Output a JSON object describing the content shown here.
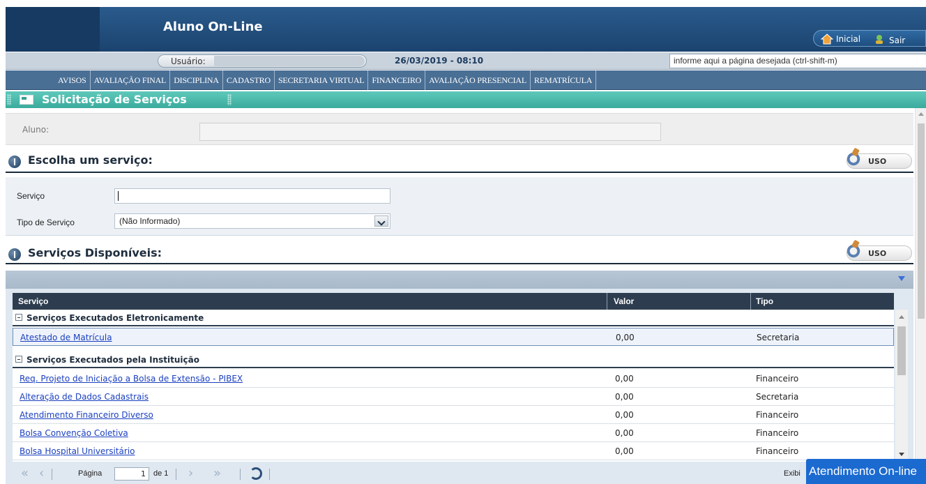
{
  "header": {
    "app_title": "Aluno On-Line",
    "actions": [
      {
        "label": "Inicial",
        "icon": "home-icon"
      },
      {
        "label": "Sair",
        "icon": "exit-icon"
      }
    ]
  },
  "userbar": {
    "user_label": "Usuário:",
    "user_value": "",
    "datetime": "26/03/2019 - 08:10",
    "page_search_value": "informe aqui a página desejada (ctrl-shift-m)"
  },
  "nav": {
    "items": [
      "AVISOS",
      "AVALIAÇÃO FINAL",
      "DISCIPLINA",
      "CADASTRO",
      "SECRETARIA VIRTUAL",
      "FINANCEIRO",
      "AVALIAÇÃO PRESENCIAL",
      "REMATRÍCULA"
    ]
  },
  "section": {
    "title": "Solicitação de Serviços",
    "aluno_label": "Aluno:",
    "aluno_value": ""
  },
  "escolha": {
    "heading": "Escolha um serviço:",
    "uso_label": "USO",
    "servico_label": "Serviço",
    "servico_value": "",
    "tipo_label": "Tipo de Serviço",
    "tipo_selected": "(Não Informado)"
  },
  "disponiveis": {
    "heading": "Serviços Disponíveis:",
    "uso_label": "USO",
    "columns": [
      "Serviço",
      "Valor",
      "Tipo"
    ],
    "groups": [
      {
        "name": "Serviços Executados Eletronicamente",
        "rows": [
          {
            "servico": "Atestado de Matrícula",
            "valor": "0,00",
            "tipo": "Secretaria"
          }
        ]
      },
      {
        "name": "Serviços Executados pela Instituição",
        "rows": [
          {
            "servico": "Req. Projeto de Iniciação a Bolsa de Extensão - PIBEX",
            "valor": "0,00",
            "tipo": "Financeiro"
          },
          {
            "servico": "Alteração de Dados Cadastrais",
            "valor": "0,00",
            "tipo": "Secretaria"
          },
          {
            "servico": "Atendimento Financeiro Diverso",
            "valor": "0,00",
            "tipo": "Financeiro"
          },
          {
            "servico": "Bolsa Convenção Coletiva",
            "valor": "0,00",
            "tipo": "Financeiro"
          },
          {
            "servico": "Bolsa Hospital Universitário",
            "valor": "0,00",
            "tipo": "Financeiro"
          }
        ]
      }
    ]
  },
  "pager": {
    "page_label": "Página",
    "page_value": "1",
    "of_label": "de 1",
    "display_label": "Exibi"
  },
  "chat": {
    "label": "Atendimento On-line"
  },
  "colors": {
    "header_blue": "#1b436f",
    "nav_blue": "#4a6f95",
    "section_teal": "#3aab9d",
    "grid_header": "#2d3d4f",
    "link_blue": "#1a3fbf",
    "chat_blue": "#1b6ad0"
  }
}
